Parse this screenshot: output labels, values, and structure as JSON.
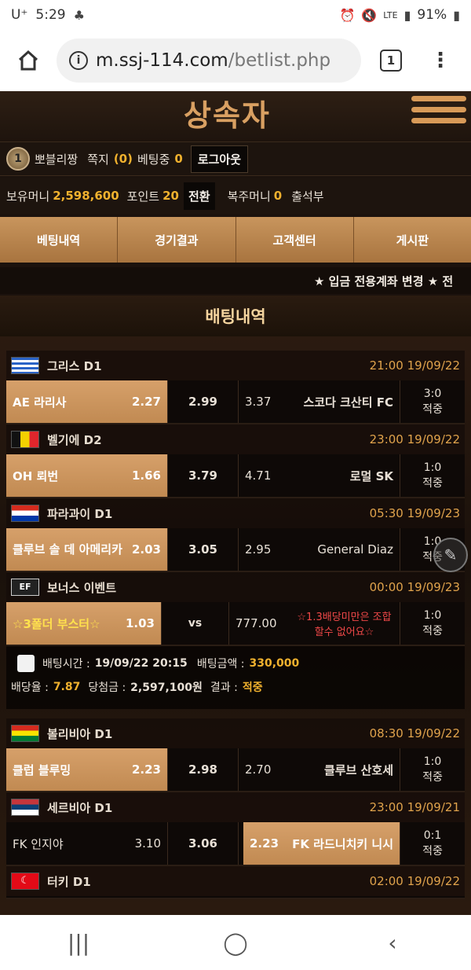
{
  "status": {
    "carrier": "U⁺",
    "time": "5:29",
    "network": "LTE",
    "battery": "91%"
  },
  "browser": {
    "url_domain": "m.ssj-114.com",
    "url_path": "/betlist.php",
    "tab_count": "1"
  },
  "site": {
    "logo": "상속자",
    "user": {
      "level": "1",
      "nickname": "뽀블리짱",
      "memo_label": "쪽지",
      "memo_count": "(0)",
      "betting_label": "베팅중",
      "betting_count": "0",
      "logout": "로그아웃"
    },
    "money": {
      "hold_label": "보유머니",
      "hold_value": "2,598,600",
      "point_label": "포인트",
      "point_value": "20",
      "swap": "전환",
      "restore_label": "복주머니",
      "restore_value": "0",
      "attendance": "출석부"
    },
    "nav": [
      "베팅내역",
      "경기결과",
      "고객센터",
      "게시판"
    ],
    "ticker": "★ 입금 전용계좌 변경 ★ 전",
    "section_title": "배팅내역"
  },
  "bets": [
    {
      "league": "그리스 D1",
      "time": "21:00 19/09/22",
      "home": "AE 라리사",
      "home_odd": "2.27",
      "draw": "2.99",
      "away_odd": "3.37",
      "away": "스코다 크산티 FC",
      "score": "3:0",
      "result": "적중"
    },
    {
      "league": "벨기에 D2",
      "time": "23:00 19/09/22",
      "home": "OH 뢰번",
      "home_odd": "1.66",
      "draw": "3.79",
      "away_odd": "4.71",
      "away": "로멀 SK",
      "score": "1:0",
      "result": "적중"
    },
    {
      "league": "파라과이 D1",
      "time": "05:30 19/09/23",
      "home": "클루브 솔 데 아메리카",
      "home_odd": "2.03",
      "draw": "3.05",
      "away_odd": "2.95",
      "away": "General Diaz",
      "score": "1:0",
      "result": "적중"
    },
    {
      "league": "보너스 이벤트",
      "time": "00:00 19/09/23",
      "home": "☆3폴더 부스터☆",
      "home_odd": "1.03",
      "draw": "vs",
      "away_odd": "777.00",
      "away": "☆1.3배당미만은 조합 할수 없어요☆",
      "score": "1:0",
      "result": "적중"
    }
  ],
  "bet_summary": {
    "time_label": "배팅시간 :",
    "time_value": "19/09/22 20:15",
    "amount_label": "배팅금액 :",
    "amount_value": "330,000",
    "rate_label": "배당율 :",
    "rate_value": "7.87",
    "win_label": "당첨금 :",
    "win_value": "2,597,100원",
    "result_label": "결과 :",
    "result_value": "적중"
  },
  "bets2": [
    {
      "league": "볼리비아 D1",
      "time": "08:30 19/09/22",
      "home": "클럽 블루밍",
      "home_odd": "2.23",
      "draw": "2.98",
      "away_odd": "2.70",
      "away": "클루브 산호세",
      "score": "1:0",
      "result": "적중"
    },
    {
      "league": "세르비아 D1",
      "time": "23:00 19/09/21",
      "home": "FK 인지야",
      "home_odd": "3.10",
      "draw": "3.06",
      "away_odd": "2.23",
      "away": "FK 라드니치키 니시",
      "score": "0:1",
      "result": "적중"
    },
    {
      "league": "터키 D1",
      "time": "02:00 19/09/22"
    }
  ],
  "colors": {
    "accent_gold": "#f0b12e",
    "selected_bg": "#c18a52",
    "time_orange": "#e0a34c"
  }
}
